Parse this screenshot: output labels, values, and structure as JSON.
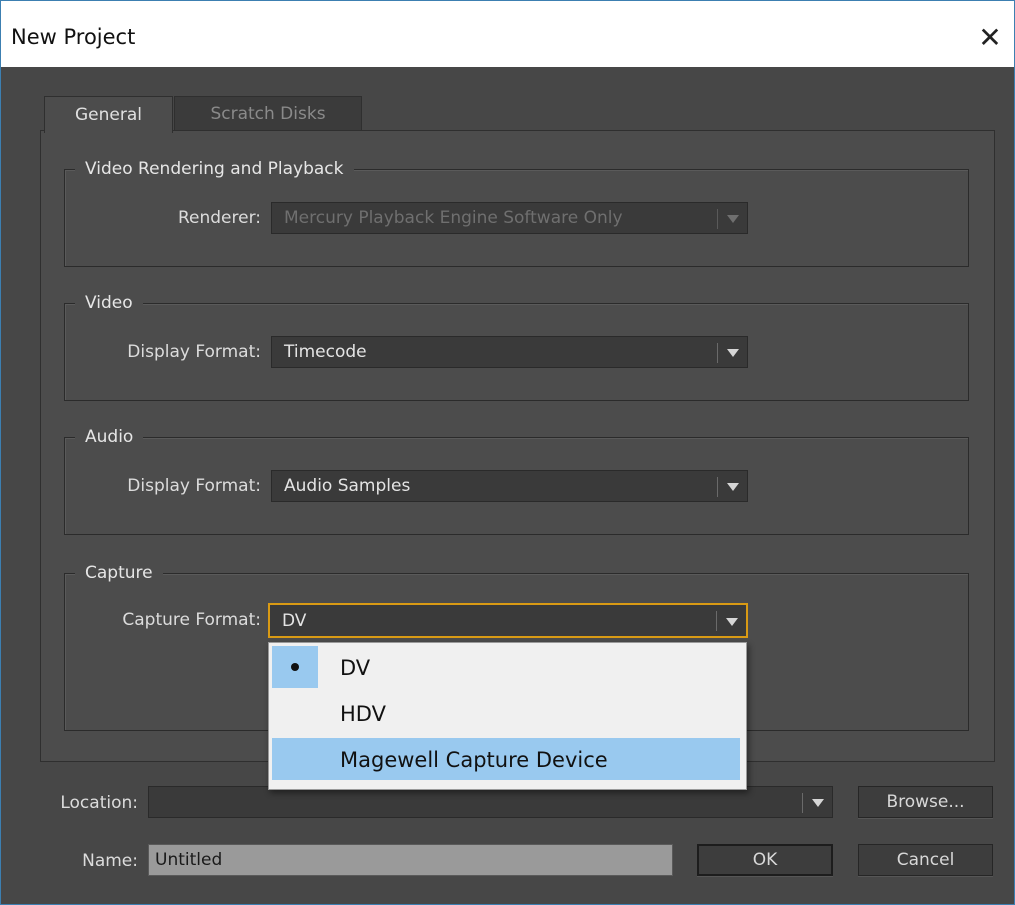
{
  "window": {
    "title": "New Project"
  },
  "tabs": [
    {
      "label": "General",
      "active": true
    },
    {
      "label": "Scratch Disks",
      "active": false
    }
  ],
  "groups": {
    "video_rendering": {
      "title": "Video Rendering and Playback",
      "renderer_label": "Renderer:",
      "renderer_value": "Mercury Playback Engine Software Only",
      "renderer_disabled": true
    },
    "video": {
      "title": "Video",
      "display_format_label": "Display Format:",
      "display_format_value": "Timecode"
    },
    "audio": {
      "title": "Audio",
      "display_format_label": "Display Format:",
      "display_format_value": "Audio Samples"
    },
    "capture": {
      "title": "Capture",
      "capture_format_label": "Capture Format:",
      "capture_format_value": "DV",
      "options": [
        {
          "label": "DV",
          "selected": true
        },
        {
          "label": "HDV",
          "selected": false
        },
        {
          "label": "Magewell Capture Device",
          "selected": false,
          "hovered": true
        }
      ]
    }
  },
  "footer": {
    "location_label": "Location:",
    "location_value": "",
    "browse_label": "Browse...",
    "name_label": "Name:",
    "name_value": "Untitled",
    "ok_label": "OK",
    "cancel_label": "Cancel"
  },
  "colors": {
    "dialog_bg": "#474747",
    "panel_bg": "#4c4c4c",
    "focus_accent": "#d99a14",
    "menu_highlight": "#99c9ef"
  }
}
